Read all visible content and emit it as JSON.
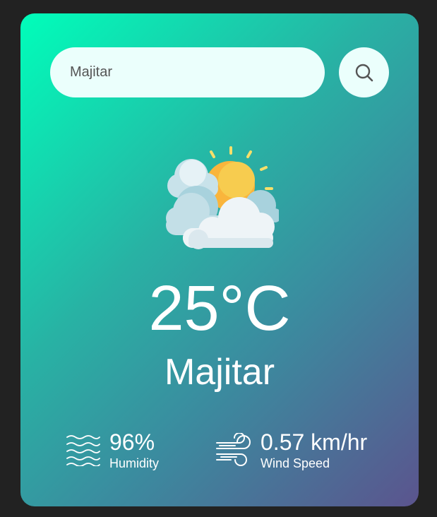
{
  "search": {
    "value": "Majitar",
    "icon": "search-icon"
  },
  "weather": {
    "icon": "partly-cloudy-icon",
    "temperature": "25°C",
    "city": "Majitar"
  },
  "humidity": {
    "icon": "humidity-waves-icon",
    "value": "96%",
    "label": "Humidity"
  },
  "wind": {
    "icon": "wind-icon",
    "value": "0.57 km/hr",
    "label": "Wind Speed"
  },
  "colors": {
    "background": "#222222",
    "gradient_start": "#00feba",
    "gradient_end": "#5b548e",
    "input_bg": "#ebfffc",
    "text": "#ffffff"
  }
}
